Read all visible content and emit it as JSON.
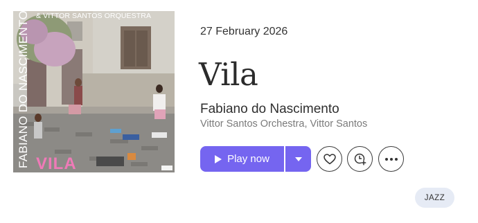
{
  "album": {
    "release_date": "27 February 2026",
    "title": "Vila",
    "artist": "Fabiano do Nascimento",
    "featured_artists": "Vittor Santos Orchestra, Vittor Santos"
  },
  "cover": {
    "vertical_text": "FABIANO DO NASCIMENTO",
    "orchestra_text": "& VITTOR SANTOS ORQUESTRA",
    "title_text": "VILA",
    "title_color": "#f07ab8"
  },
  "actions": {
    "play_label": "Play now",
    "play_icon": "play-icon",
    "dropdown_icon": "caret-down-icon",
    "like_icon": "heart-icon",
    "add_icon": "add-to-queue-icon",
    "more_icon": "more-dots-icon",
    "accent_color": "#7565f0"
  },
  "genre": {
    "label": "JAZZ"
  }
}
